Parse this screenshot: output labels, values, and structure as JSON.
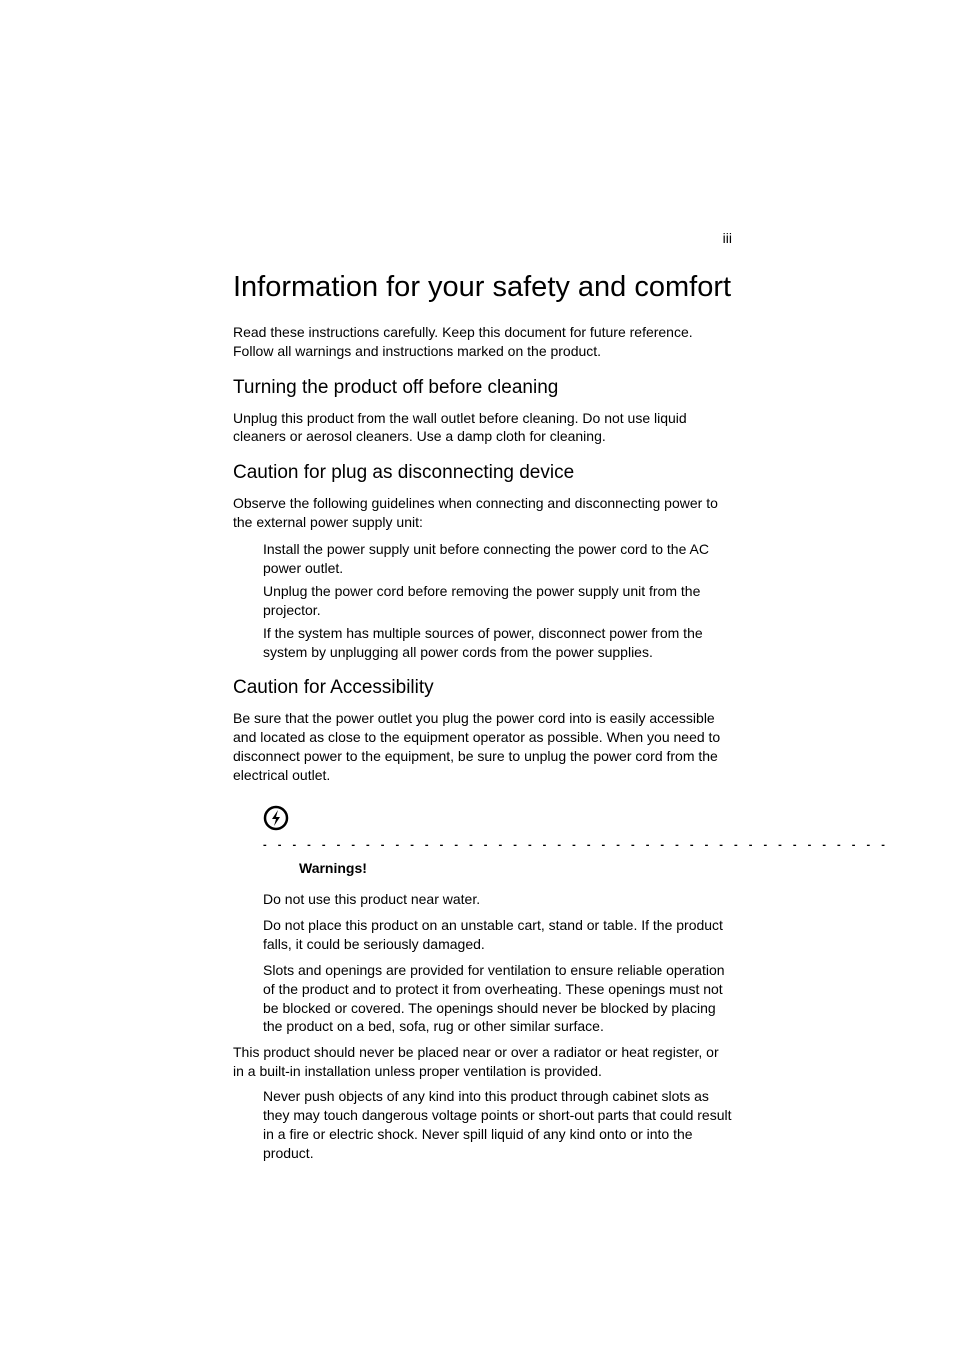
{
  "pageNumber": "iii",
  "title": "Information for your safety and comfort",
  "intro": "Read these instructions carefully. Keep this document for future reference. Follow all warnings and instructions marked on the product.",
  "sections": {
    "s1": {
      "heading": "Turning the product off before cleaning",
      "body": "Unplug this product from the wall outlet before cleaning. Do not use liquid cleaners or aerosol cleaners. Use a damp cloth for cleaning."
    },
    "s2": {
      "heading": "Caution for plug as disconnecting device",
      "body": "Observe the following guidelines when connecting and disconnecting power to the external power supply unit:",
      "items": {
        "i0": "Install the power supply unit before connecting the power cord to the AC power outlet.",
        "i1": "Unplug the power cord before removing the power supply unit from the projector.",
        "i2": "If the system has multiple sources of power, disconnect power from the system by unplugging all power cords from the power supplies."
      }
    },
    "s3": {
      "heading": "Caution for Accessibility",
      "body": "Be sure that the power outlet you plug the power cord into is easily accessible and located as close to the equipment operator as possible. When you need to disconnect power to the equipment, be sure to unplug the power cord from the electrical outlet."
    }
  },
  "warningLabel": "Warnings!",
  "warnings": {
    "w0": "Do not use this product near water.",
    "w1": "Do not place this product on an unstable cart, stand or table. If the product falls, it could be seriously damaged.",
    "w2": "Slots and openings are provided for ventilation to ensure reliable operation of the product and to protect it from overheating. These openings must not be blocked or covered. The openings should never be blocked by placing the product on a bed, sofa, rug or other similar surface."
  },
  "afterWarnings": "This product should never be placed near or over a radiator or heat register, or in a built-in installation unless proper ventilation is provided.",
  "finalItem": "Never push objects of any kind into this product through cabinet slots as they may touch dangerous voltage points or short-out parts that could result in a fire or electric shock. Never spill liquid of any kind onto or into the product."
}
